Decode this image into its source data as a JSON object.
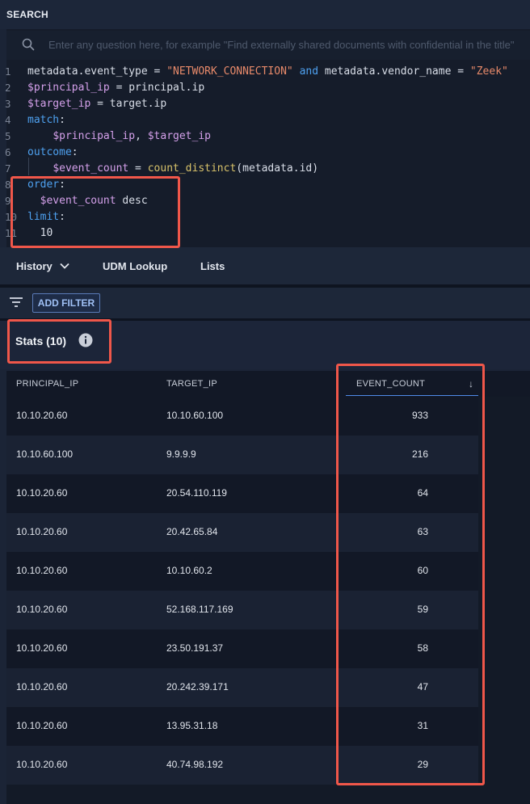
{
  "panel": {
    "title": "SEARCH"
  },
  "search": {
    "placeholder": "Enter any question here, for example \"Find externally shared documents with confidential in the title\""
  },
  "query_lines": [
    {
      "n": "1",
      "segments": [
        [
          "metadata.event_type = ",
          "t"
        ],
        [
          "\"NETWORK_CONNECTION\"",
          "s"
        ],
        [
          " ",
          "t"
        ],
        [
          "and",
          "k"
        ],
        [
          " metadata.vendor_name = ",
          "t"
        ],
        [
          "\"Zeek\"",
          "s"
        ]
      ]
    },
    {
      "n": "2",
      "segments": [
        [
          "$principal_ip",
          "v"
        ],
        [
          " = principal.ip",
          "t"
        ]
      ]
    },
    {
      "n": "3",
      "segments": [
        [
          "$target_ip",
          "v"
        ],
        [
          " = target.ip",
          "t"
        ]
      ]
    },
    {
      "n": "4",
      "segments": [
        [
          "match",
          "k"
        ],
        [
          ":",
          "t"
        ]
      ]
    },
    {
      "n": "5",
      "segments": [
        [
          "    ",
          "t"
        ],
        [
          "$principal_ip",
          "v"
        ],
        [
          ", ",
          "t"
        ],
        [
          "$target_ip",
          "v"
        ]
      ]
    },
    {
      "n": "6",
      "segments": [
        [
          "outcome",
          "k"
        ],
        [
          ":",
          "t"
        ]
      ]
    },
    {
      "n": "7",
      "segments": [
        [
          "    ",
          "t"
        ],
        [
          "$event_count",
          "v"
        ],
        [
          " = ",
          "t"
        ],
        [
          "count_distinct",
          "f"
        ],
        [
          "(metadata.id)",
          "t"
        ]
      ]
    },
    {
      "n": "8",
      "segments": [
        [
          "order",
          "k"
        ],
        [
          ":",
          "t"
        ]
      ]
    },
    {
      "n": "9",
      "segments": [
        [
          "  ",
          "t"
        ],
        [
          "$event_count",
          "v"
        ],
        [
          " desc",
          "t"
        ]
      ]
    },
    {
      "n": "10",
      "segments": [
        [
          "limit",
          "k"
        ],
        [
          ":",
          "t"
        ]
      ]
    },
    {
      "n": "11",
      "segments": [
        [
          "  10",
          "t"
        ]
      ]
    }
  ],
  "tabs": {
    "history": "History",
    "udm_lookup": "UDM Lookup",
    "lists": "Lists"
  },
  "filter": {
    "add_label": "ADD FILTER"
  },
  "stats": {
    "title": "Stats (10)"
  },
  "table": {
    "columns": [
      "PRINCIPAL_IP",
      "TARGET_IP",
      "EVENT_COUNT"
    ],
    "sort_indicator": "↓",
    "rows": [
      [
        "10.10.20.60",
        "10.10.60.100",
        "933"
      ],
      [
        "10.10.60.100",
        "9.9.9.9",
        "216"
      ],
      [
        "10.10.20.60",
        "20.54.110.119",
        "64"
      ],
      [
        "10.10.20.60",
        "20.42.65.84",
        "63"
      ],
      [
        "10.10.20.60",
        "10.10.60.2",
        "60"
      ],
      [
        "10.10.20.60",
        "52.168.117.169",
        "59"
      ],
      [
        "10.10.20.60",
        "23.50.191.37",
        "58"
      ],
      [
        "10.10.20.60",
        "20.242.39.171",
        "47"
      ],
      [
        "10.10.20.60",
        "13.95.31.18",
        "31"
      ],
      [
        "10.10.20.60",
        "40.74.98.192",
        "29"
      ]
    ]
  },
  "colors": {
    "highlight": "#f0574a",
    "accent": "#4f8ae8",
    "keyword": "#4ea1f0",
    "string": "#e88a6a",
    "variable": "#d4a0ea"
  }
}
